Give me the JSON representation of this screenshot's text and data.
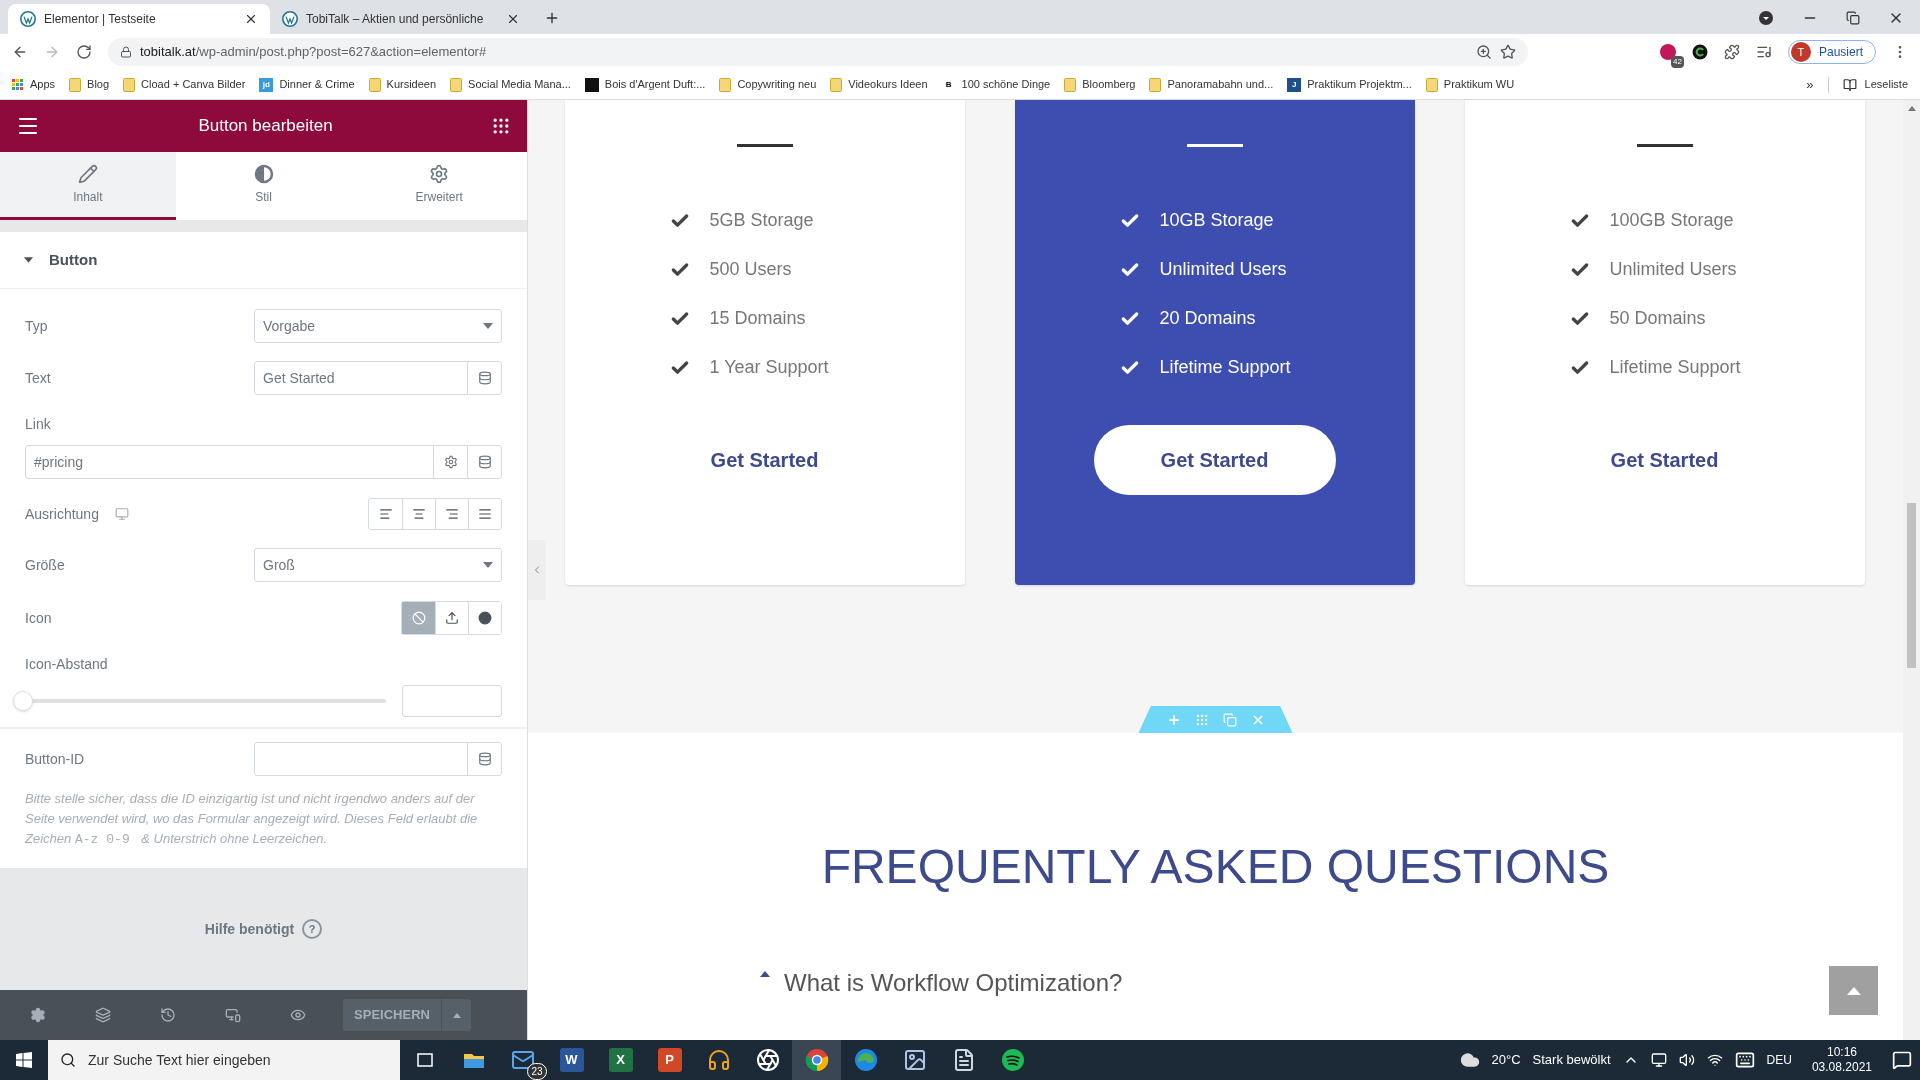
{
  "browser": {
    "tabs": [
      {
        "title": "Elementor | Testseite",
        "selected": true
      },
      {
        "title": "TobiTalk – Aktien und persönliche",
        "selected": false
      }
    ],
    "url_host": "tobitalk.at",
    "url_path": "/wp-admin/post.php?post=627&action=elementor#",
    "extension_badge": "42",
    "profile_initial": "T",
    "profile_label": "Pausiert",
    "bookmarks": [
      {
        "kind": "apps",
        "label": "Apps"
      },
      {
        "kind": "folder",
        "label": "Blog"
      },
      {
        "kind": "folder",
        "label": "Cload + Canva Bilder"
      },
      {
        "kind": "site",
        "label": "Dinner & Crime",
        "mark": "jd",
        "color": "#3a9bd9"
      },
      {
        "kind": "folder",
        "label": "Kursideen"
      },
      {
        "kind": "folder",
        "label": "Social Media Mana..."
      },
      {
        "kind": "site",
        "label": "Bois d'Argent Duft:...",
        "color": "#111111"
      },
      {
        "kind": "folder",
        "label": "Copywriting neu"
      },
      {
        "kind": "folder",
        "label": "Videokurs Ideen"
      },
      {
        "kind": "site",
        "label": "100 schöne Dinge",
        "mark": "B",
        "color": "#ffffff"
      },
      {
        "kind": "folder",
        "label": "Bloomberg"
      },
      {
        "kind": "folder",
        "label": "Panoramabahn und..."
      },
      {
        "kind": "site",
        "label": "Praktikum Projektm...",
        "mark": "J",
        "color": "#1e4e8c"
      },
      {
        "kind": "folder",
        "label": "Praktikum WU"
      }
    ],
    "more": "»",
    "reading_list": "Leseliste"
  },
  "editor": {
    "title": "Button bearbeiten",
    "tabs": [
      {
        "label": "Inhalt",
        "selected": true
      },
      {
        "label": "Stil",
        "selected": false
      },
      {
        "label": "Erweitert",
        "selected": false
      }
    ],
    "section": {
      "title": "Button",
      "expanded": true
    },
    "typ": {
      "label": "Typ",
      "value": "Vorgabe"
    },
    "text": {
      "label": "Text",
      "value": "Get Started"
    },
    "link": {
      "label": "Link",
      "value": "#pricing"
    },
    "alignment": {
      "label": "Ausrichtung"
    },
    "size": {
      "label": "Größe",
      "value": "Groß"
    },
    "icon": {
      "label": "Icon",
      "options": [
        {
          "selected": true
        },
        {
          "selected": false
        },
        {
          "selected": false
        }
      ]
    },
    "icon_spacing": {
      "label": "Icon-Abstand",
      "level": 0
    },
    "button_id": {
      "label": "Button-ID"
    },
    "help_parts": [
      {
        "kind": "text",
        "text": "Bitte stelle sicher, dass die ID einzigartig ist und nicht irgendwo anders auf der Seite verwendet wird, wo das Formular angezeigt wird. Dieses Feld erlaubt die Zeichen "
      },
      {
        "kind": "code",
        "text": "A-z"
      },
      {
        "kind": "code",
        "text": "0-9"
      },
      {
        "kind": "text",
        "text": " & Unterstrich ohne Leerzeichen."
      }
    ],
    "help_link": "Hilfe benötigt",
    "help_mark": "?",
    "save": "SPEICHERN"
  },
  "page": {
    "plans": [
      {
        "highlighted": false,
        "features": [
          "5GB Storage",
          "500 Users",
          "15 Domains",
          "1 Year Support"
        ],
        "button": "Get Started"
      },
      {
        "highlighted": true,
        "features": [
          "10GB Storage",
          "Unlimited Users",
          "20 Domains",
          "Lifetime Support"
        ],
        "button": "Get Started"
      },
      {
        "highlighted": false,
        "features": [
          "100GB Storage",
          "Unlimited Users",
          "50 Domains",
          "Lifetime Support"
        ],
        "button": "Get Started"
      }
    ],
    "faq_title": "FREQUENTLY ASKED QUESTIONS",
    "faq_items": [
      {
        "question": "What is Workflow Optimization?",
        "expanded": true
      }
    ]
  },
  "taskbar": {
    "search_placeholder": "Zur Suche Text hier eingeben",
    "apps": [
      {
        "kind": "taskview"
      },
      {
        "kind": "explorer"
      },
      {
        "kind": "mail",
        "badge": "23"
      },
      {
        "kind": "office",
        "letter": "W",
        "color": "#2b579a"
      },
      {
        "kind": "office",
        "letter": "X",
        "color": "#217346"
      },
      {
        "kind": "office",
        "letter": "P",
        "color": "#d24726"
      },
      {
        "kind": "audio"
      },
      {
        "kind": "obs"
      },
      {
        "kind": "chrome",
        "active": true
      },
      {
        "kind": "edge"
      },
      {
        "kind": "paint"
      },
      {
        "kind": "notepad"
      },
      {
        "kind": "spotify"
      }
    ],
    "temperature": "20°C",
    "weather": "Stark bewölkt",
    "language": "DEU",
    "time": "10:16",
    "date": "03.08.2021"
  }
}
